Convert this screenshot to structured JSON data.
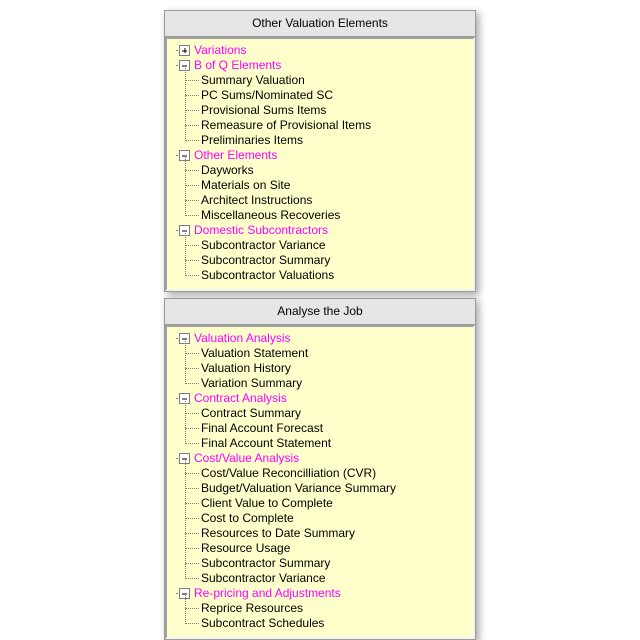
{
  "panels": [
    {
      "title": "Other Valuation Elements",
      "nodes": [
        {
          "label": "Variations",
          "expanded": false,
          "children": []
        },
        {
          "label": "B of Q Elements",
          "expanded": true,
          "children": [
            "Summary Valuation",
            "PC Sums/Nominated SC",
            "Provisional Sums Items",
            "Remeasure of Provisional Items",
            "Preliminaries Items"
          ]
        },
        {
          "label": "Other Elements",
          "expanded": true,
          "children": [
            "Dayworks",
            "Materials on Site",
            "Architect Instructions",
            "Miscellaneous Recoveries"
          ]
        },
        {
          "label": "Domestic Subcontractors",
          "expanded": true,
          "children": [
            "Subcontractor Variance",
            "Subcontractor Summary",
            "Subcontractor Valuations"
          ]
        }
      ]
    },
    {
      "title": "Analyse the Job",
      "nodes": [
        {
          "label": "Valuation Analysis",
          "expanded": true,
          "children": [
            "Valuation Statement",
            "Valuation History",
            "Variation Summary"
          ]
        },
        {
          "label": "Contract Analysis",
          "expanded": true,
          "children": [
            "Contract Summary",
            "Final Account Forecast",
            "Final Account Statement"
          ]
        },
        {
          "label": "Cost/Value Analysis",
          "expanded": true,
          "children": [
            "Cost/Value Reconcilliation (CVR)",
            "Budget/Valuation Variance Summary",
            "Client Value to Complete",
            "Cost to Complete",
            "Resources to Date Summary",
            "Resource Usage",
            "Subcontractor Summary",
            "Subcontractor Variance"
          ]
        },
        {
          "label": "Re-pricing and Adjustments",
          "expanded": true,
          "children": [
            "Reprice Resources",
            "Subcontract Schedules"
          ]
        }
      ]
    }
  ]
}
